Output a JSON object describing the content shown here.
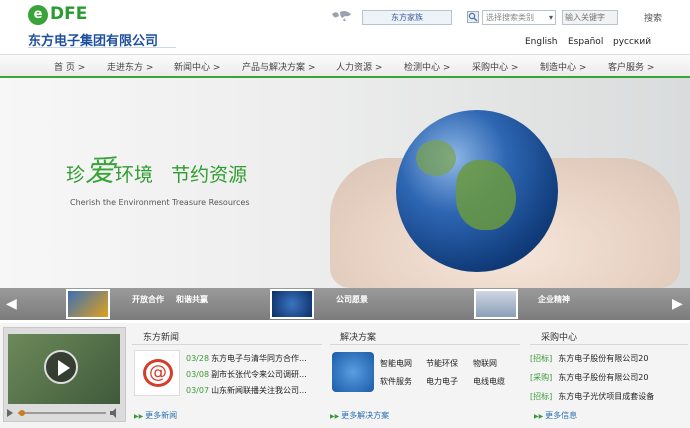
{
  "header": {
    "logo_text": "DFE",
    "company_name": "东方电子集团有限公司",
    "site_select": "东方家族",
    "category_select": "选择搜索类别",
    "keyword_placeholder": "输入关键字",
    "search_label": "搜索",
    "languages": [
      "English",
      "Español",
      "русский"
    ]
  },
  "nav": {
    "items": [
      "首 页 >",
      "走进东方 >",
      "新闻中心 >",
      "产品与解决方案 >",
      "人力资源 >",
      "检测中心 >",
      "采购中心 >",
      "制造中心 >",
      "客户服务 >"
    ]
  },
  "banner": {
    "slogan_a": "珍",
    "slogan_b": "爱",
    "slogan_c": "环境",
    "slogan_d": "节约资源",
    "slogan_en": "Cherish the Environment Treasure Resources"
  },
  "strip": {
    "labels": [
      "开放合作",
      "和谐共赢",
      "公司愿景",
      "企业精神"
    ]
  },
  "news": {
    "title": "东方新闻",
    "items": [
      {
        "date": "03/28",
        "text": "东方电子与清华同方合作..."
      },
      {
        "date": "03/08",
        "text": "副市长张代令来公司调研..."
      },
      {
        "date": "03/07",
        "text": "山东新闻联播关注我公司..."
      }
    ],
    "more": "更多新闻"
  },
  "solutions": {
    "title": "解决方案",
    "items": [
      "智能电网",
      "节能环保",
      "物联网",
      "软件服务",
      "电力电子",
      "电线电缆"
    ],
    "more": "更多解决方案"
  },
  "purchase": {
    "title": "采购中心",
    "items": [
      {
        "tag": "[招标]",
        "text": "东方电子股份有限公司20"
      },
      {
        "tag": "[采购]",
        "text": "东方电子股份有限公司20"
      },
      {
        "tag": "[招标]",
        "text": "东方电子光伏项目成套设备"
      }
    ],
    "more": "更多信息"
  },
  "colors": {
    "brand_green": "#3aa33a",
    "brand_blue": "#1f4f9f",
    "link_blue": "#2a6fb5"
  }
}
